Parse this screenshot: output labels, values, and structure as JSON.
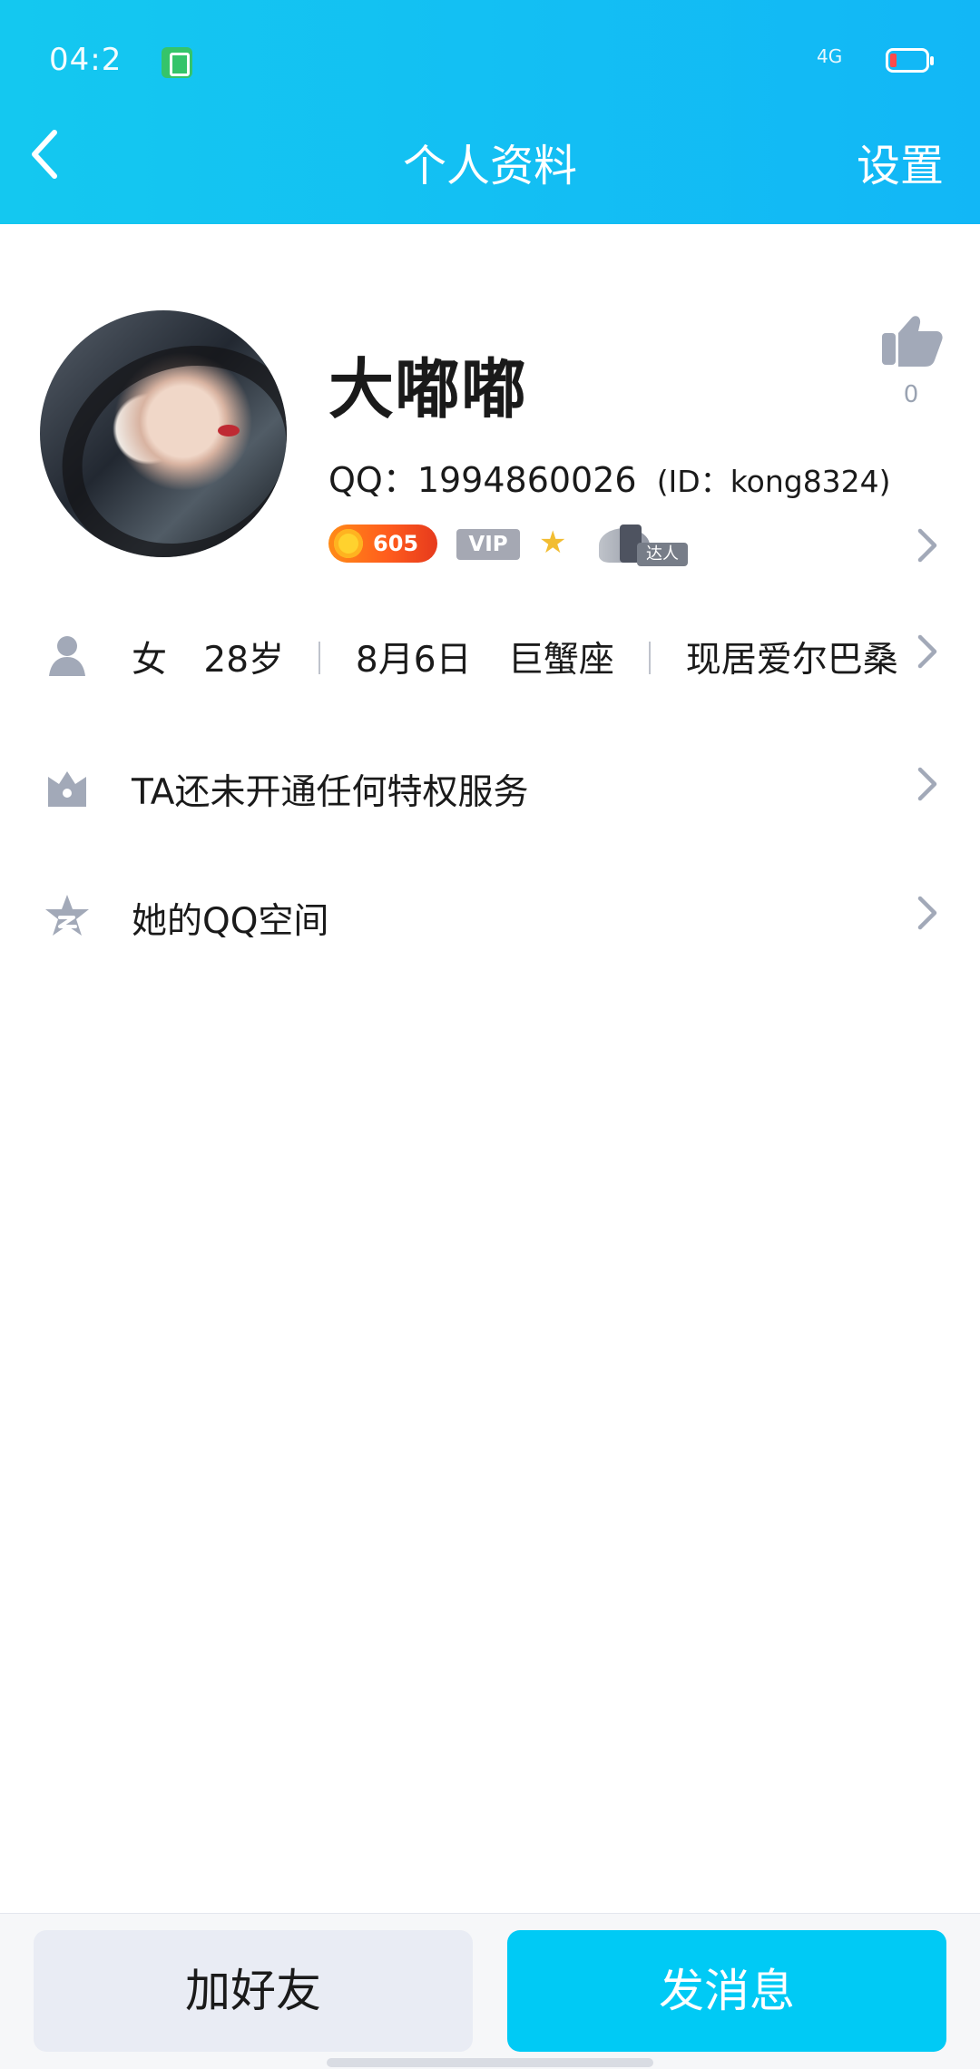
{
  "status_bar": {
    "time": "04:2",
    "network": "4G"
  },
  "header": {
    "title": "个人资料",
    "settings_label": "设置"
  },
  "profile": {
    "name": "大嘟嘟",
    "qq_label": "QQ：1994860026",
    "id_label": "(ID：kong8324)",
    "likes": "0",
    "level_badge": "605",
    "vip_badge": "VIP",
    "master_badge": "达人"
  },
  "rows": [
    {
      "icon": "person-icon",
      "gender": "女",
      "age": "28岁",
      "birthday": "8月6日",
      "zodiac": "巨蟹座",
      "location": "现居爱尔巴桑"
    },
    {
      "icon": "crown-icon",
      "label": "TA还未开通任何特权服务"
    },
    {
      "icon": "qzone-star-icon",
      "label": "她的QQ空间"
    }
  ],
  "bottom_bar": {
    "add_friend": "加好友",
    "send_message": "发消息"
  },
  "colors": {
    "header": "#14c8f0",
    "primary_button": "#00caf5",
    "secondary_button": "#e9ecf4"
  }
}
